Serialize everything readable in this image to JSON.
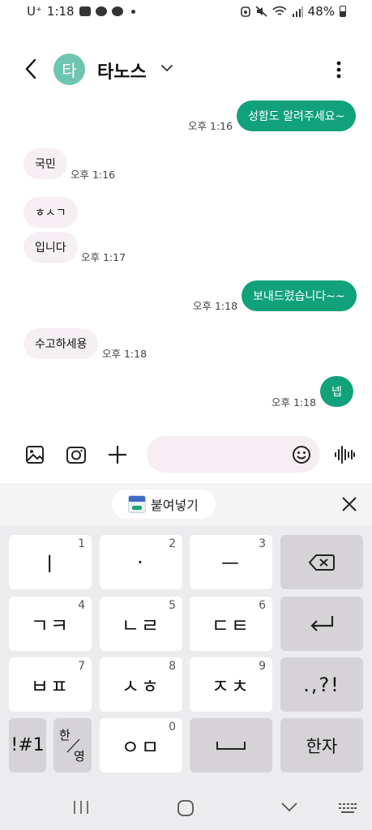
{
  "status_bar": {
    "carrier": "U⁺",
    "time": "1:18",
    "battery": "48%",
    "battery_level": 0.48
  },
  "header": {
    "avatar_initial": "타",
    "contact_name": "타노스",
    "avatar_color": "#6fc6b0"
  },
  "messages": [
    {
      "dir": "sent",
      "text": "성함도 알려주세요~",
      "time": "오후 1:16"
    },
    {
      "dir": "recv",
      "text": "국민",
      "time": "오후 1:16"
    },
    {
      "dir": "recv",
      "text": "ㅎㅅㄱ",
      "time": ""
    },
    {
      "dir": "recv",
      "text": "입니다",
      "time": "오후 1:17"
    },
    {
      "dir": "sent",
      "text": "보내드렸습니다~~",
      "time": "오후 1:18"
    },
    {
      "dir": "recv",
      "text": "수고하세용",
      "time": "오후 1:18"
    },
    {
      "dir": "sent",
      "text": "넵",
      "time": "오후 1:18"
    }
  ],
  "colors": {
    "sent_bubble": "#12a27b",
    "recv_bubble": "#f6eff3"
  },
  "clipboard": {
    "paste_label": "붙여넣기"
  },
  "keyboard": {
    "keys": [
      {
        "label": "ㅣ",
        "num": "1"
      },
      {
        "label": "·",
        "num": "2"
      },
      {
        "label": "ㅡ",
        "num": "3"
      },
      {
        "label": "ㄱㅋ",
        "num": "4"
      },
      {
        "label": "ㄴㄹ",
        "num": "5"
      },
      {
        "label": "ㄷㅌ",
        "num": "6"
      },
      {
        "label": "ㅂㅍ",
        "num": "7"
      },
      {
        "label": "ㅅㅎ",
        "num": "8"
      },
      {
        "label": "ㅈㅊ",
        "num": "9"
      },
      {
        "label": "ㅇㅁ",
        "num": "0"
      }
    ],
    "punct_label": ".,?!",
    "symbols_label": "!#1",
    "lang_top": "한",
    "lang_bottom": "영",
    "hanja_label": "한자"
  }
}
